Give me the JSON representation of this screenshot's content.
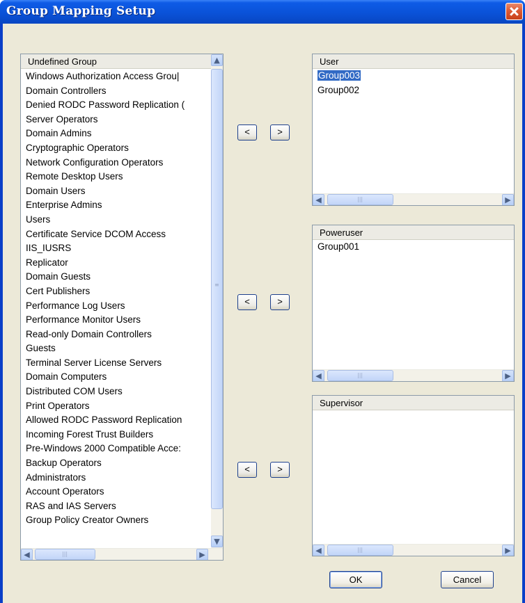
{
  "dialog": {
    "title": "Group Mapping Setup"
  },
  "undefined_panel": {
    "header": "Undefined Group",
    "items": [
      "Windows Authorization Access Grou|",
      "Domain Controllers",
      "Denied RODC Password Replication (",
      "Server Operators",
      "Domain Admins",
      "Cryptographic Operators",
      "Network Configuration Operators",
      "Remote Desktop Users",
      "Domain Users",
      "Enterprise Admins",
      "Users",
      "Certificate Service DCOM Access",
      "IIS_IUSRS",
      "Replicator",
      "Domain Guests",
      "Cert Publishers",
      "Performance Log Users",
      "Performance Monitor Users",
      "Read-only Domain Controllers",
      "Guests",
      "Terminal Server License Servers",
      "Domain Computers",
      "Distributed COM Users",
      "Print Operators",
      "Allowed RODC Password Replication",
      "Incoming Forest Trust Builders",
      "Pre-Windows 2000 Compatible Acce:",
      "Backup Operators",
      "Administrators",
      "Account Operators",
      "RAS and IAS Servers",
      "Group Policy Creator Owners"
    ]
  },
  "user_panel": {
    "header": "User",
    "items": [
      "Group003",
      "Group002"
    ],
    "selected": "Group003"
  },
  "poweruser_panel": {
    "header": "Poweruser",
    "items": [
      "Group001"
    ]
  },
  "supervisor_panel": {
    "header": "Supervisor",
    "items": []
  },
  "move_buttons": {
    "move_left": "<",
    "move_right": ">"
  },
  "buttons": {
    "ok": "OK",
    "cancel": "Cancel"
  },
  "icons": {
    "scroll_up": "▲",
    "scroll_down": "▼",
    "scroll_left": "◀",
    "scroll_right": "▶"
  }
}
